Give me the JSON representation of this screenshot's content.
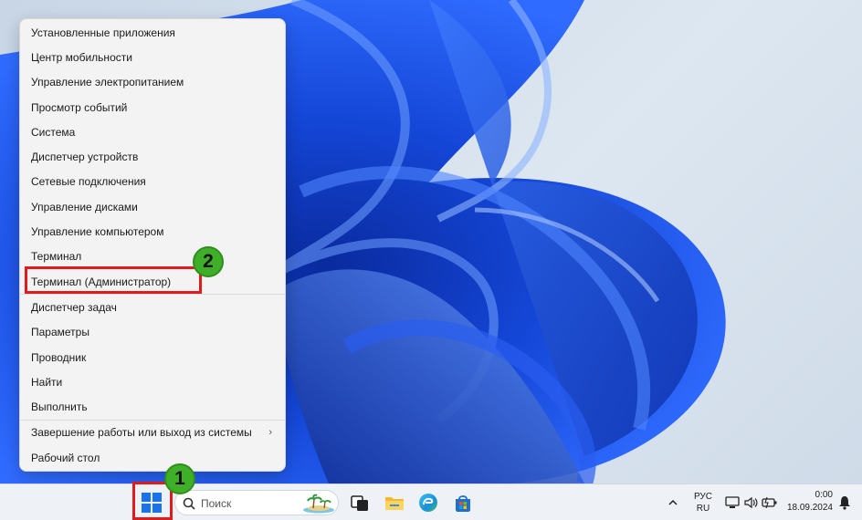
{
  "context_menu": {
    "items": [
      {
        "label": "Установленные приложения"
      },
      {
        "label": "Центр мобильности"
      },
      {
        "label": "Управление электропитанием"
      },
      {
        "label": "Просмотр событий"
      },
      {
        "label": "Система"
      },
      {
        "label": "Диспетчер устройств"
      },
      {
        "label": "Сетевые подключения"
      },
      {
        "label": "Управление дисками"
      },
      {
        "label": "Управление компьютером"
      },
      {
        "label": "Терминал"
      },
      {
        "label": "Терминал (Администратор)"
      },
      {
        "label": "Диспетчер задач"
      },
      {
        "label": "Параметры"
      },
      {
        "label": "Проводник"
      },
      {
        "label": "Найти"
      },
      {
        "label": "Выполнить"
      },
      {
        "label": "Завершение работы или выход из системы"
      },
      {
        "label": "Рабочий стол"
      }
    ]
  },
  "annotations": {
    "step1": "1",
    "step2": "2",
    "highlight_color": "#e01b1b",
    "badge_color": "#3fae29"
  },
  "taskbar": {
    "search_placeholder": "Поиск",
    "language_line1": "РУС",
    "language_line2": "RU",
    "time": "0:00",
    "date": "18.09.2024",
    "icons": [
      "windows-start-icon",
      "search-icon",
      "task-view-icon",
      "file-explorer-icon",
      "edge-icon",
      "store-icon",
      "chevron-up-icon",
      "network-icon",
      "volume-icon",
      "battery-icon",
      "notification-bell-icon"
    ]
  }
}
